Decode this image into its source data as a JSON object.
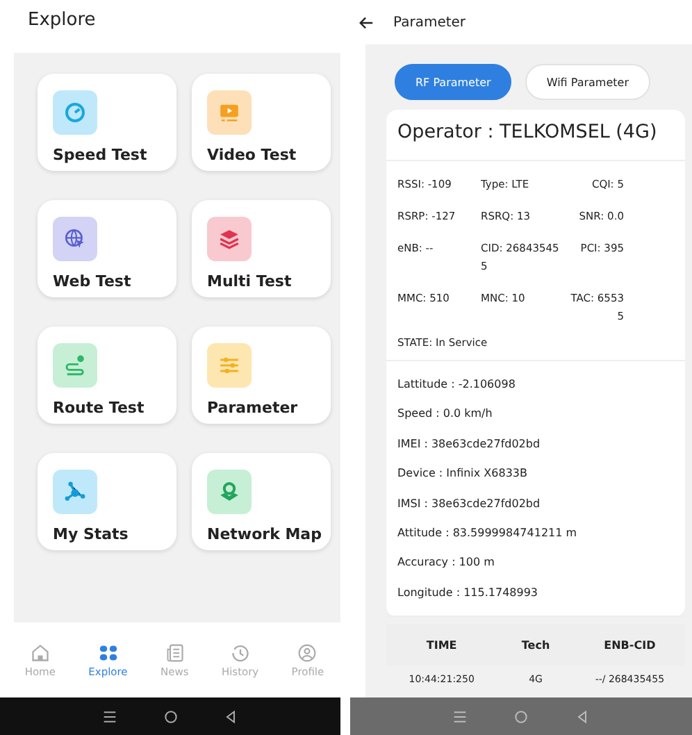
{
  "explore": {
    "title": "Explore",
    "tiles": [
      {
        "label": "Speed Test",
        "kind": "speed"
      },
      {
        "label": "Video Test",
        "kind": "video"
      },
      {
        "label": "Web Test",
        "kind": "web"
      },
      {
        "label": "Multi Test",
        "kind": "multi"
      },
      {
        "label": "Route Test",
        "kind": "route"
      },
      {
        "label": "Parameter",
        "kind": "parameter"
      },
      {
        "label": "My Stats",
        "kind": "stats"
      },
      {
        "label": "Network Map",
        "kind": "map"
      }
    ],
    "nav": [
      {
        "label": "Home",
        "kind": "home",
        "selected": false
      },
      {
        "label": "Explore",
        "kind": "explore",
        "selected": true
      },
      {
        "label": "News",
        "kind": "news",
        "selected": false
      },
      {
        "label": "History",
        "kind": "history",
        "selected": false
      },
      {
        "label": "Profile",
        "kind": "profile",
        "selected": false
      }
    ]
  },
  "parameter": {
    "title": "Parameter",
    "tabs": [
      {
        "label": "RF Parameter",
        "selected": true
      },
      {
        "label": "Wifi Parameter",
        "selected": false
      }
    ],
    "operator": "Operator : TELKOMSEL (4G)",
    "cells": [
      "RSSI: -109",
      "Type: LTE",
      "CQI: 5",
      "RSRP: -127",
      "RSRQ: 13",
      "SNR: 0.0",
      "eNB: --",
      "CID: 268435455",
      "PCI: 395",
      "MMC: 510",
      "MNC: 10",
      "TAC: 65535"
    ],
    "state": "STATE: In Service",
    "info": [
      "Lattitude : -2.106098",
      "Speed : 0.0 km/h",
      "IMEI : 38e63cde27fd02bd",
      "Device : Infinix X6833B",
      "IMSI : 38e63cde27fd02bd",
      "Attitude : 83.5999984741211 m",
      "Accuracy : 100 m",
      "Longitude : 115.1748993"
    ],
    "table": {
      "columns": [
        "TIME",
        "Tech",
        "ENB-CID"
      ],
      "rows": [
        [
          "10:44:21:250",
          "4G",
          "--/ 268435455"
        ]
      ]
    }
  }
}
